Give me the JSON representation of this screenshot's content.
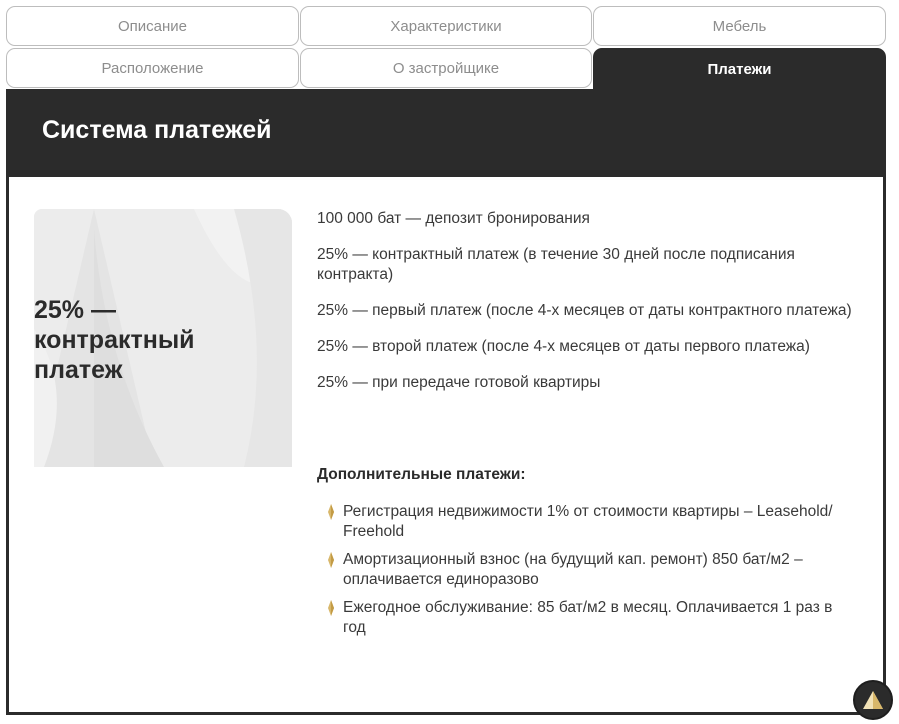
{
  "tabs": [
    {
      "label": "Описание"
    },
    {
      "label": "Характеристики"
    },
    {
      "label": "Мебель"
    },
    {
      "label": "Расположение"
    },
    {
      "label": "О застройщике"
    },
    {
      "label": "Платежи",
      "active": true
    }
  ],
  "panel": {
    "title": "Система платежей",
    "card_text": "25% — контрактный платеж",
    "lines": [
      "100 000 бат — депозит бронирования",
      "25% — контрактный платеж (в течение 30 дней после подписания контракта)",
      "25% — первый платеж (после 4-х месяцев от даты контрактного платежа)",
      "25% — второй платеж (после 4-х месяцев от даты первого платежа)",
      "25% — при передаче готовой квартиры"
    ],
    "extra_title": "Дополнительные платежи:",
    "extra_items": [
      "Регистрация недвижимости 1% от стоимости квартиры – Leasehold/ Freehold",
      "Амортизационный взнос (на будущий кап. ремонт) 850 бат/м2 – оплачивается единоразово",
      "Ежегодное обслуживание: 85 бат/м2 в месяц. Оплачивается 1 раз в год"
    ]
  },
  "icons": {
    "bullet": "gold-diamond-bullet-icon",
    "scroll_top": "arrow-up-icon"
  },
  "colors": {
    "dark": "#2b2b2b",
    "accent_gold": "#d8b76a",
    "tab_text": "#8d8d8d"
  }
}
